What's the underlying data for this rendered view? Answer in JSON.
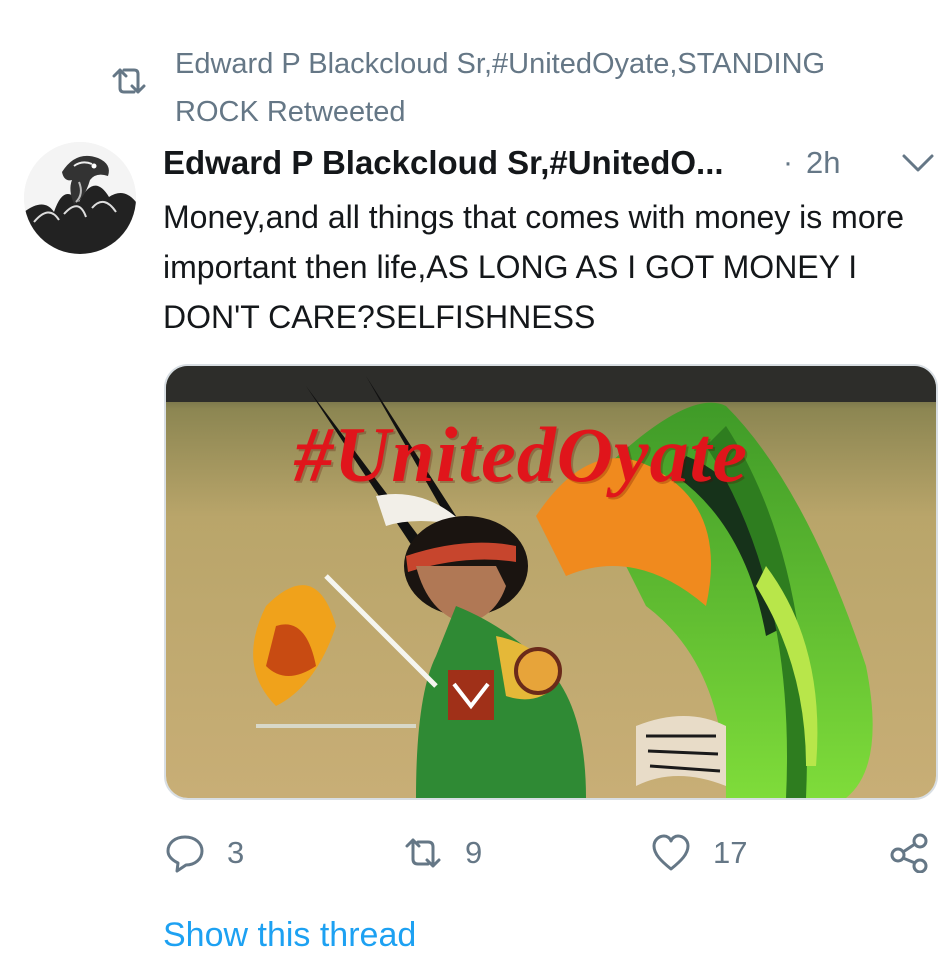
{
  "retweet": {
    "text": "Edward P Blackcloud Sr,#UnitedOyate,STANDING ROCK Retweeted",
    "icon": "retweet-icon"
  },
  "tweet": {
    "author_name": "Edward P Blackcloud Sr,#UnitedO...",
    "separator": "·",
    "time": "2h",
    "text": "Money,and all things that comes with money is more important then life,AS LONG AS I GOT MONEY I DON'T CARE?SELFISHNESS",
    "media": {
      "overlay_text": "#UnitedOyate"
    },
    "actions": {
      "replies": "3",
      "retweets": "9",
      "likes": "17"
    },
    "show_thread": "Show this thread"
  },
  "colors": {
    "secondary_text": "#657786",
    "link": "#1da1f2",
    "overlay_red": "#e0151b"
  }
}
